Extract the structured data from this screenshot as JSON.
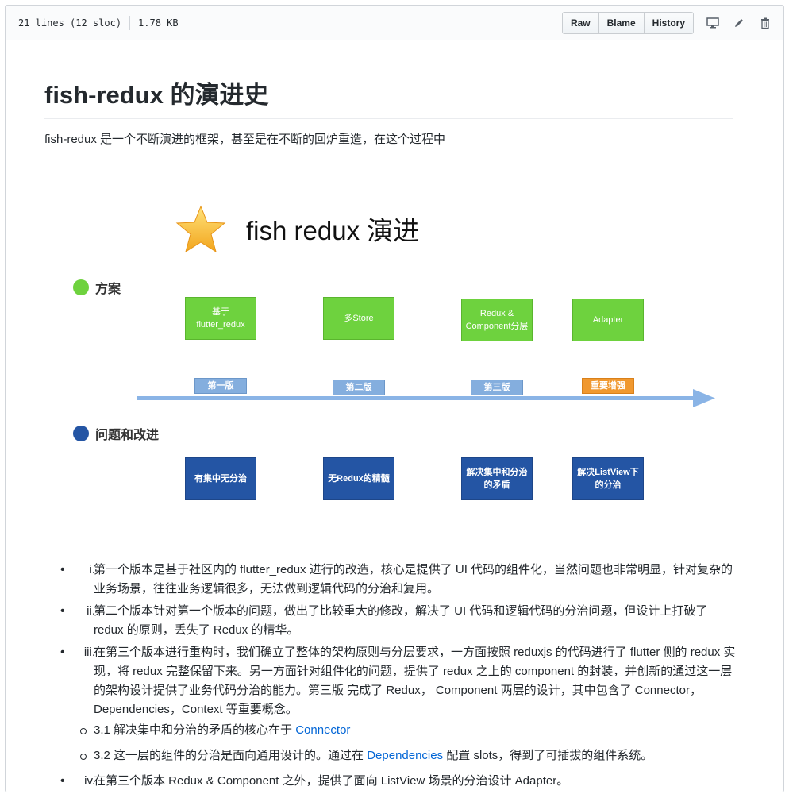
{
  "header": {
    "lines": "21 lines (12 sloc)",
    "size": "1.78 KB",
    "buttons": [
      "Raw",
      "Blame",
      "History"
    ]
  },
  "content": {
    "title": "fish-redux 的演进史",
    "intro": "fish-redux 是一个不断演进的框架，甚至是在不断的回炉重造，在这个过程中"
  },
  "diagram": {
    "title": "fish redux 演进",
    "section_plan": "方案",
    "section_issue": "问题和改进",
    "plans": [
      [
        "基于",
        "flutter_redux"
      ],
      [
        "多Store"
      ],
      [
        "Redux &",
        "Component分层"
      ],
      [
        "Adapter"
      ]
    ],
    "versions": [
      "第一版",
      "第二版",
      "第三版",
      "重要增强"
    ],
    "issues": [
      [
        "有集中无分治"
      ],
      [
        "无Redux的精髓"
      ],
      [
        "解决集中和分治",
        "的矛盾"
      ],
      [
        "解决ListView下",
        "的分治"
      ]
    ],
    "colors": {
      "green": "#6ed23e",
      "blue": "#2455a4",
      "version": "#84aede",
      "orange": "#f0982f",
      "arrow": "#8ab4e6"
    }
  },
  "list": [
    {
      "num": "i.",
      "text": "第一个版本是基于社区内的 flutter_redux 进行的改造，核心是提供了 UI 代码的组件化，当然问题也非常明显，针对复杂的业务场景，往往业务逻辑很多，无法做到逻辑代码的分治和复用。"
    },
    {
      "num": "ii.",
      "text": "第二个版本针对第一个版本的问题，做出了比较重大的修改，解决了 UI 代码和逻辑代码的分治问题，但设计上打破了 redux 的原则，丢失了 Redux 的精华。"
    },
    {
      "num": "iii.",
      "text": "在第三个版本进行重构时，我们确立了整体的架构原则与分层要求，一方面按照 reduxjs 的代码进行了 flutter 侧的 redux 实现，将 redux 完整保留下来。另一方面针对组件化的问题，提供了 redux 之上的 component 的封装，并创新的通过这一层的架构设计提供了业务代码分治的能力。第三版 完成了 Redux， Component 两层的设计，其中包含了 Connector，Dependencies，Context 等重要概念。"
    },
    {
      "num": "iv.",
      "text": "在第三个版本 Redux & Component 之外，提供了面向 ListView 场景的分治设计 Adapter。"
    }
  ],
  "sublist": [
    {
      "text": "3.1 解决集中和分治的矛盾的核心在于 ",
      "link": "Connector",
      "after": ""
    },
    {
      "text": "3.2 这一层的组件的分治是面向通用设计的。通过在 ",
      "link": "Dependencies",
      "after": " 配置 slots，得到了可插拔的组件系统。"
    }
  ]
}
